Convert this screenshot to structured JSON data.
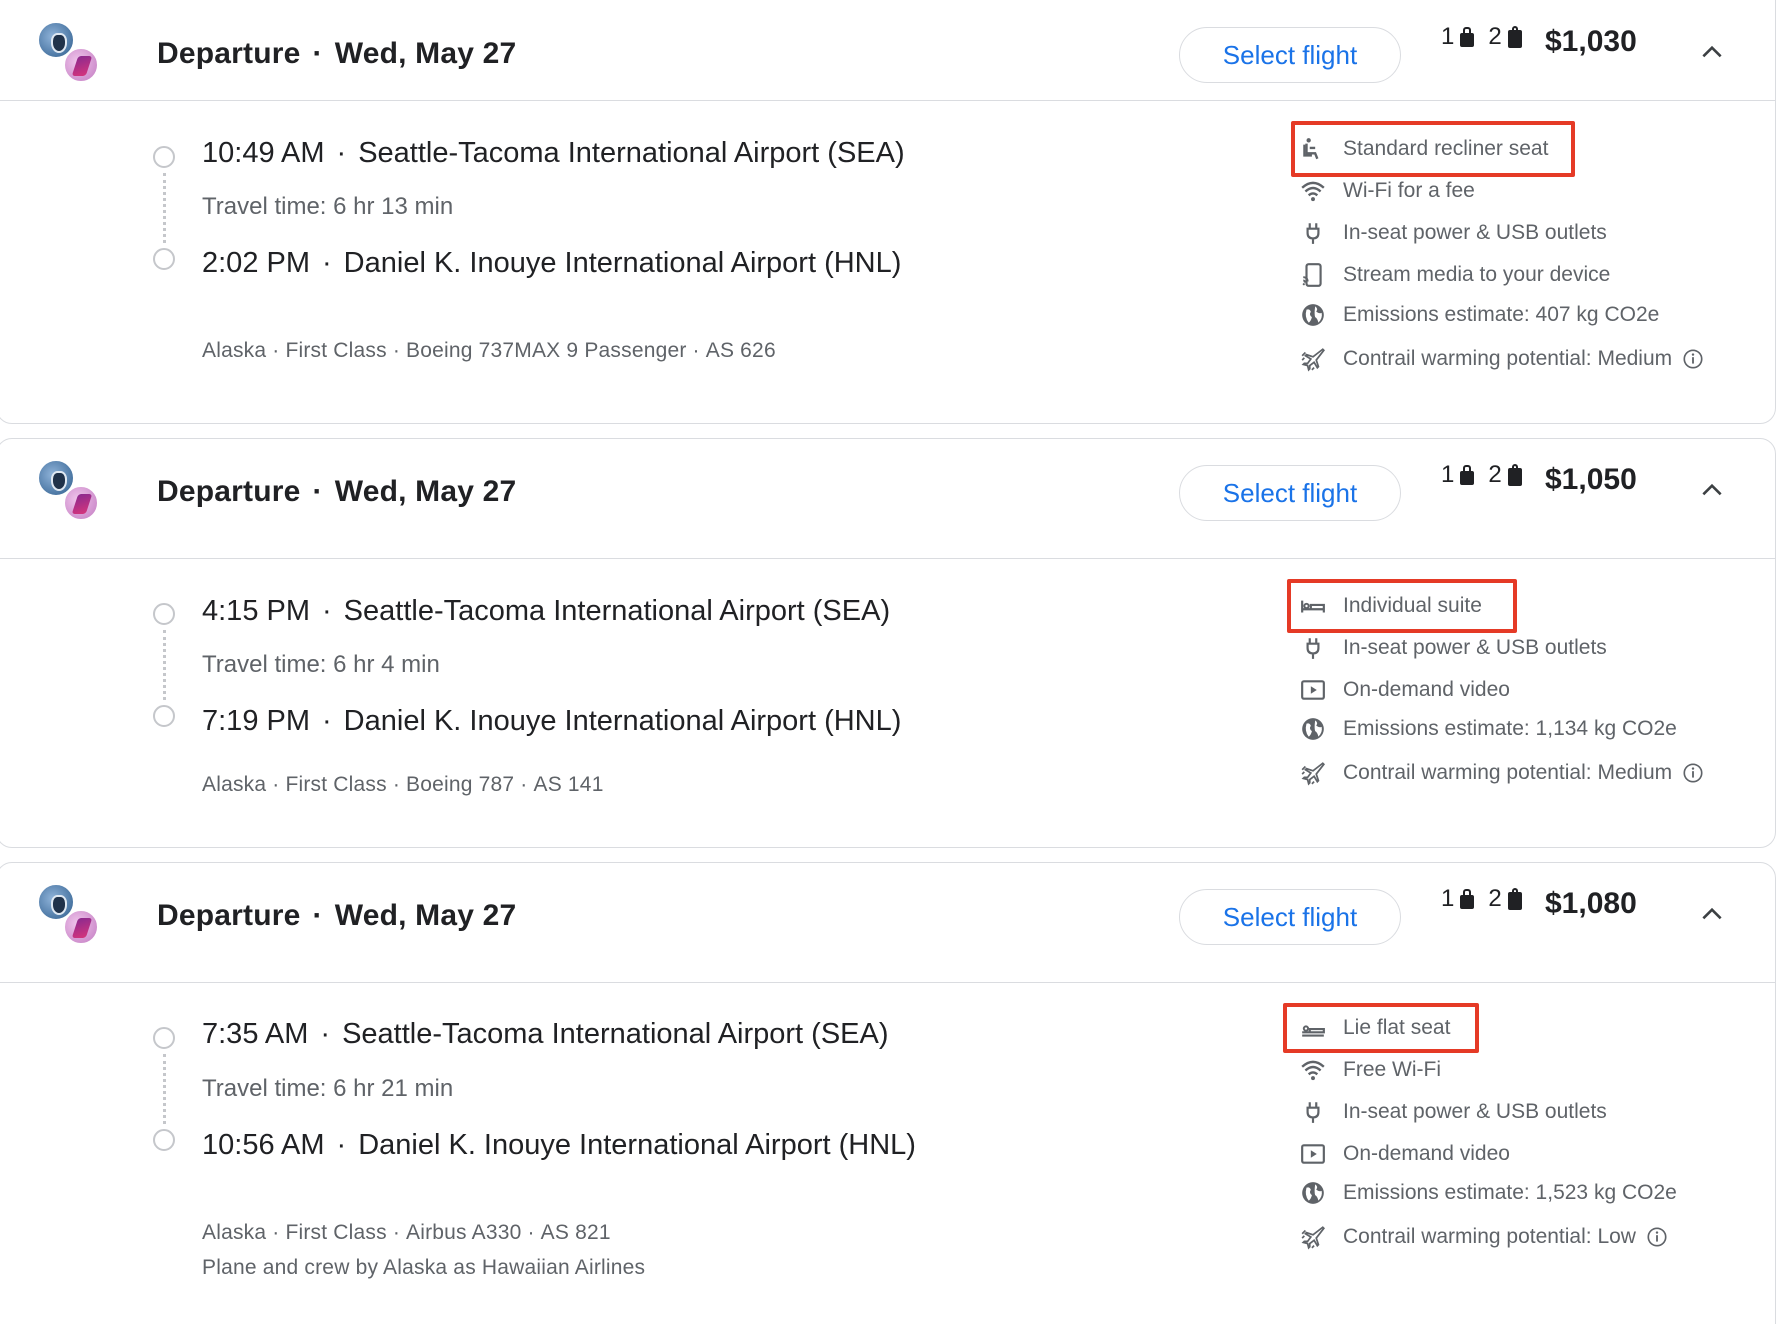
{
  "flights": [
    {
      "header": {
        "label": "Departure",
        "date": "Wed, May 27",
        "select_label": "Select flight",
        "carry_on": "1",
        "checked": "2",
        "price": "$1,030"
      },
      "segment": {
        "dep_time": "10:49 AM",
        "dep_airport": "Seattle-Tacoma International Airport (SEA)",
        "travel_time": "Travel time: 6 hr 13 min",
        "arr_time": "2:02 PM",
        "arr_airport": "Daniel K. Inouye International Airport (HNL)",
        "airline": "Alaska",
        "cabin": "First Class",
        "aircraft": "Boeing 737MAX 9 Passenger",
        "flight_no": "AS 626"
      },
      "amenities": [
        {
          "icon": "recliner-seat-icon",
          "text": "Standard recliner seat"
        },
        {
          "icon": "wifi-icon",
          "text": "Wi-Fi for a fee"
        },
        {
          "icon": "power-plug-icon",
          "text": "In-seat power & USB outlets"
        },
        {
          "icon": "stream-media-icon",
          "text": "Stream media to your device"
        },
        {
          "icon": "globe-icon",
          "text": "Emissions estimate: 407 kg CO2e"
        },
        {
          "icon": "contrail-icon",
          "text": "Contrail warming potential: Medium"
        }
      ]
    },
    {
      "header": {
        "label": "Departure",
        "date": "Wed, May 27",
        "select_label": "Select flight",
        "carry_on": "1",
        "checked": "2",
        "price": "$1,050"
      },
      "segment": {
        "dep_time": "4:15 PM",
        "dep_airport": "Seattle-Tacoma International Airport (SEA)",
        "travel_time": "Travel time: 6 hr 4 min",
        "arr_time": "7:19 PM",
        "arr_airport": "Daniel K. Inouye International Airport (HNL)",
        "airline": "Alaska",
        "cabin": "First Class",
        "aircraft": "Boeing 787",
        "flight_no": "AS 141"
      },
      "amenities": [
        {
          "icon": "suite-icon",
          "text": "Individual suite"
        },
        {
          "icon": "power-plug-icon",
          "text": "In-seat power & USB outlets"
        },
        {
          "icon": "video-icon",
          "text": "On-demand video"
        },
        {
          "icon": "globe-icon",
          "text": "Emissions estimate: 1,134 kg CO2e"
        },
        {
          "icon": "contrail-icon",
          "text": "Contrail warming potential: Medium"
        }
      ]
    },
    {
      "header": {
        "label": "Departure",
        "date": "Wed, May 27",
        "select_label": "Select flight",
        "carry_on": "1",
        "checked": "2",
        "price": "$1,080"
      },
      "segment": {
        "dep_time": "7:35 AM",
        "dep_airport": "Seattle-Tacoma International Airport (SEA)",
        "travel_time": "Travel time: 6 hr 21 min",
        "arr_time": "10:56 AM",
        "arr_airport": "Daniel K. Inouye International Airport (HNL)",
        "airline": "Alaska",
        "cabin": "First Class",
        "aircraft": "Airbus A330",
        "flight_no": "AS 821",
        "operated_by": "Plane and crew by Alaska as Hawaiian Airlines"
      },
      "amenities": [
        {
          "icon": "lie-flat-seat-icon",
          "text": "Lie flat seat"
        },
        {
          "icon": "wifi-icon",
          "text": "Free Wi-Fi"
        },
        {
          "icon": "power-plug-icon",
          "text": "In-seat power & USB outlets"
        },
        {
          "icon": "video-icon",
          "text": "On-demand video"
        },
        {
          "icon": "globe-icon",
          "text": "Emissions estimate: 1,523 kg CO2e"
        },
        {
          "icon": "contrail-icon",
          "text": "Contrail warming potential: Low"
        }
      ]
    }
  ],
  "colors": {
    "accent": "#1a73e8",
    "highlight": "#e53a26",
    "muted": "#5f6368",
    "border": "#dadce0"
  }
}
